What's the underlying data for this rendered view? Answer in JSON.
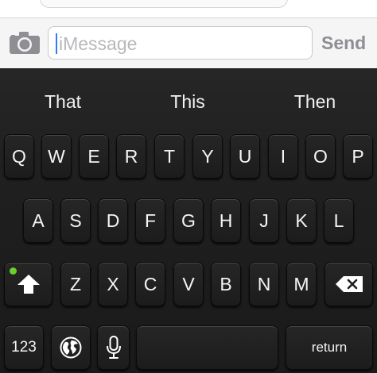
{
  "compose": {
    "placeholder": "iMessage",
    "send_label": "Send"
  },
  "suggestions": [
    "That",
    "This",
    "Then"
  ],
  "keyboard": {
    "row1": [
      "Q",
      "W",
      "E",
      "R",
      "T",
      "Y",
      "U",
      "I",
      "O",
      "P"
    ],
    "row2": [
      "A",
      "S",
      "D",
      "F",
      "G",
      "H",
      "J",
      "K",
      "L"
    ],
    "row3": [
      "Z",
      "X",
      "C",
      "V",
      "B",
      "N",
      "M"
    ],
    "numbers_label": "123",
    "return_label": "return",
    "icons": {
      "camera": "camera-icon",
      "shift": "shift-arrow-icon",
      "delete": "backspace-icon",
      "globe": "globe-icon",
      "mic": "microphone-icon"
    }
  },
  "colors": {
    "caret": "#2f7cf6",
    "shift_indicator": "#69d12c",
    "keyboard_bg": "#1c1c1c"
  }
}
